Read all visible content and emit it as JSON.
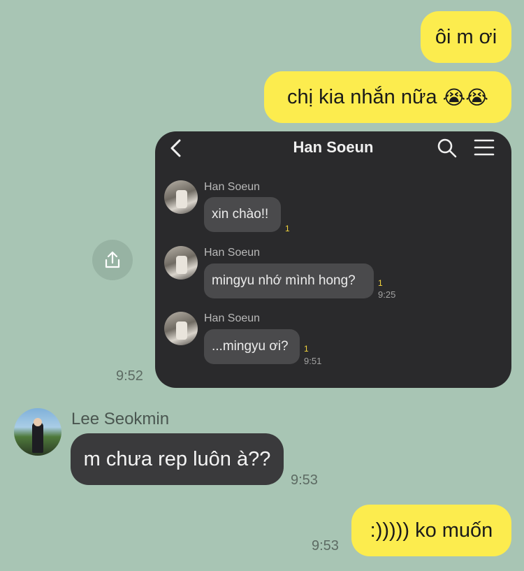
{
  "messages_out": {
    "m1": "ôi m ơi",
    "m2_text": "chị kia nhắn nữa",
    "m2_emoji": "😭😭",
    "m3": ":))))) ko muốn"
  },
  "shared_screenshot": {
    "time": "9:52",
    "header_title": "Han Soeun",
    "messages": [
      {
        "sender": "Han Soeun",
        "text": "xin chào!!",
        "unread": "1",
        "time": ""
      },
      {
        "sender": "Han Soeun",
        "text": "mingyu nhớ mình hong?",
        "unread": "1",
        "time": "9:25"
      },
      {
        "sender": "Han Soeun",
        "text": "...mingyu ơi?",
        "unread": "1",
        "time": "9:51"
      }
    ]
  },
  "incoming": {
    "sender": "Lee Seokmin",
    "text": "m chưa rep luôn à??",
    "time": "9:53"
  },
  "last_out_time": "9:53",
  "icons": {
    "share": "share-icon",
    "back": "back-arrow-icon",
    "search": "search-icon",
    "menu": "menu-icon"
  },
  "colors": {
    "background": "#a8c5b4",
    "my_bubble": "#fcec4e",
    "other_bubble": "#3a3a3c",
    "screenshot_bg": "#2a2a2c",
    "unread": "#f4d53d"
  }
}
